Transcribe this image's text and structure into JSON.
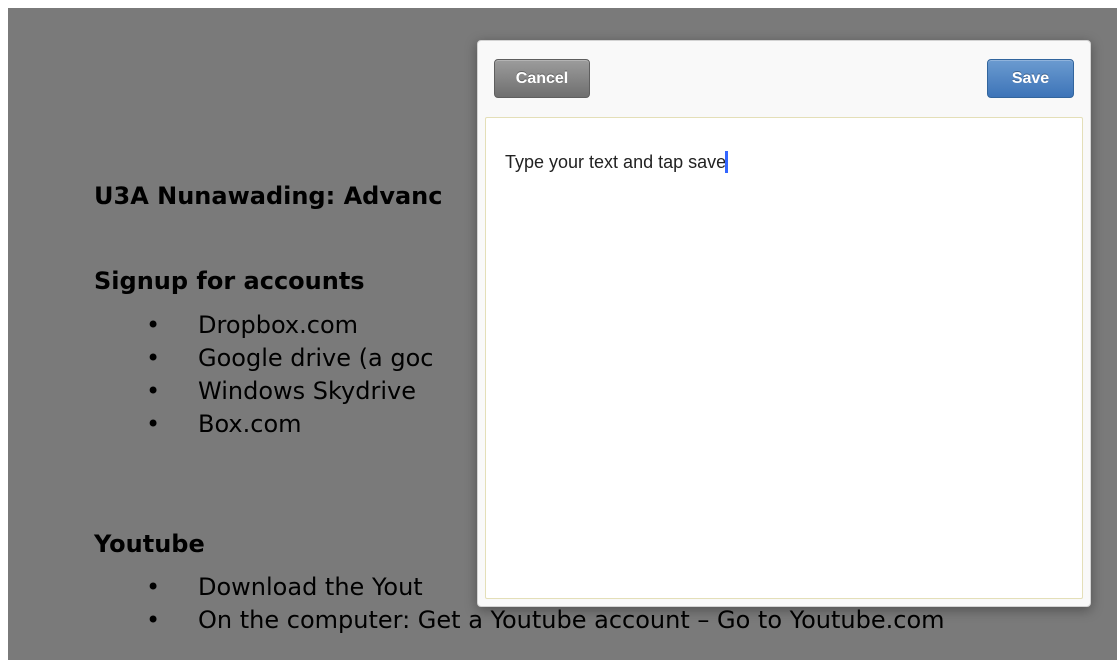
{
  "document": {
    "title": "U3A Nunawading:  Advanc",
    "sections": [
      {
        "heading": "Signup for accounts",
        "items": [
          "Dropbox.com",
          "Google drive  (a goc",
          "Windows Skydrive",
          "Box.com"
        ]
      },
      {
        "heading": "Youtube",
        "items": [
          "Download the Yout",
          "On the computer: Get a Youtube account – Go to Youtube.com"
        ]
      }
    ]
  },
  "dialog": {
    "cancel_label": "Cancel",
    "save_label": "Save",
    "text_value": "Type your text and tap save"
  },
  "colors": {
    "overlay": "#000000",
    "cancel_button": "#7f7f7f",
    "save_button": "#4f86c4",
    "caret": "#3366ff"
  },
  "icons": {
    "bullet": "bullet-dot"
  }
}
